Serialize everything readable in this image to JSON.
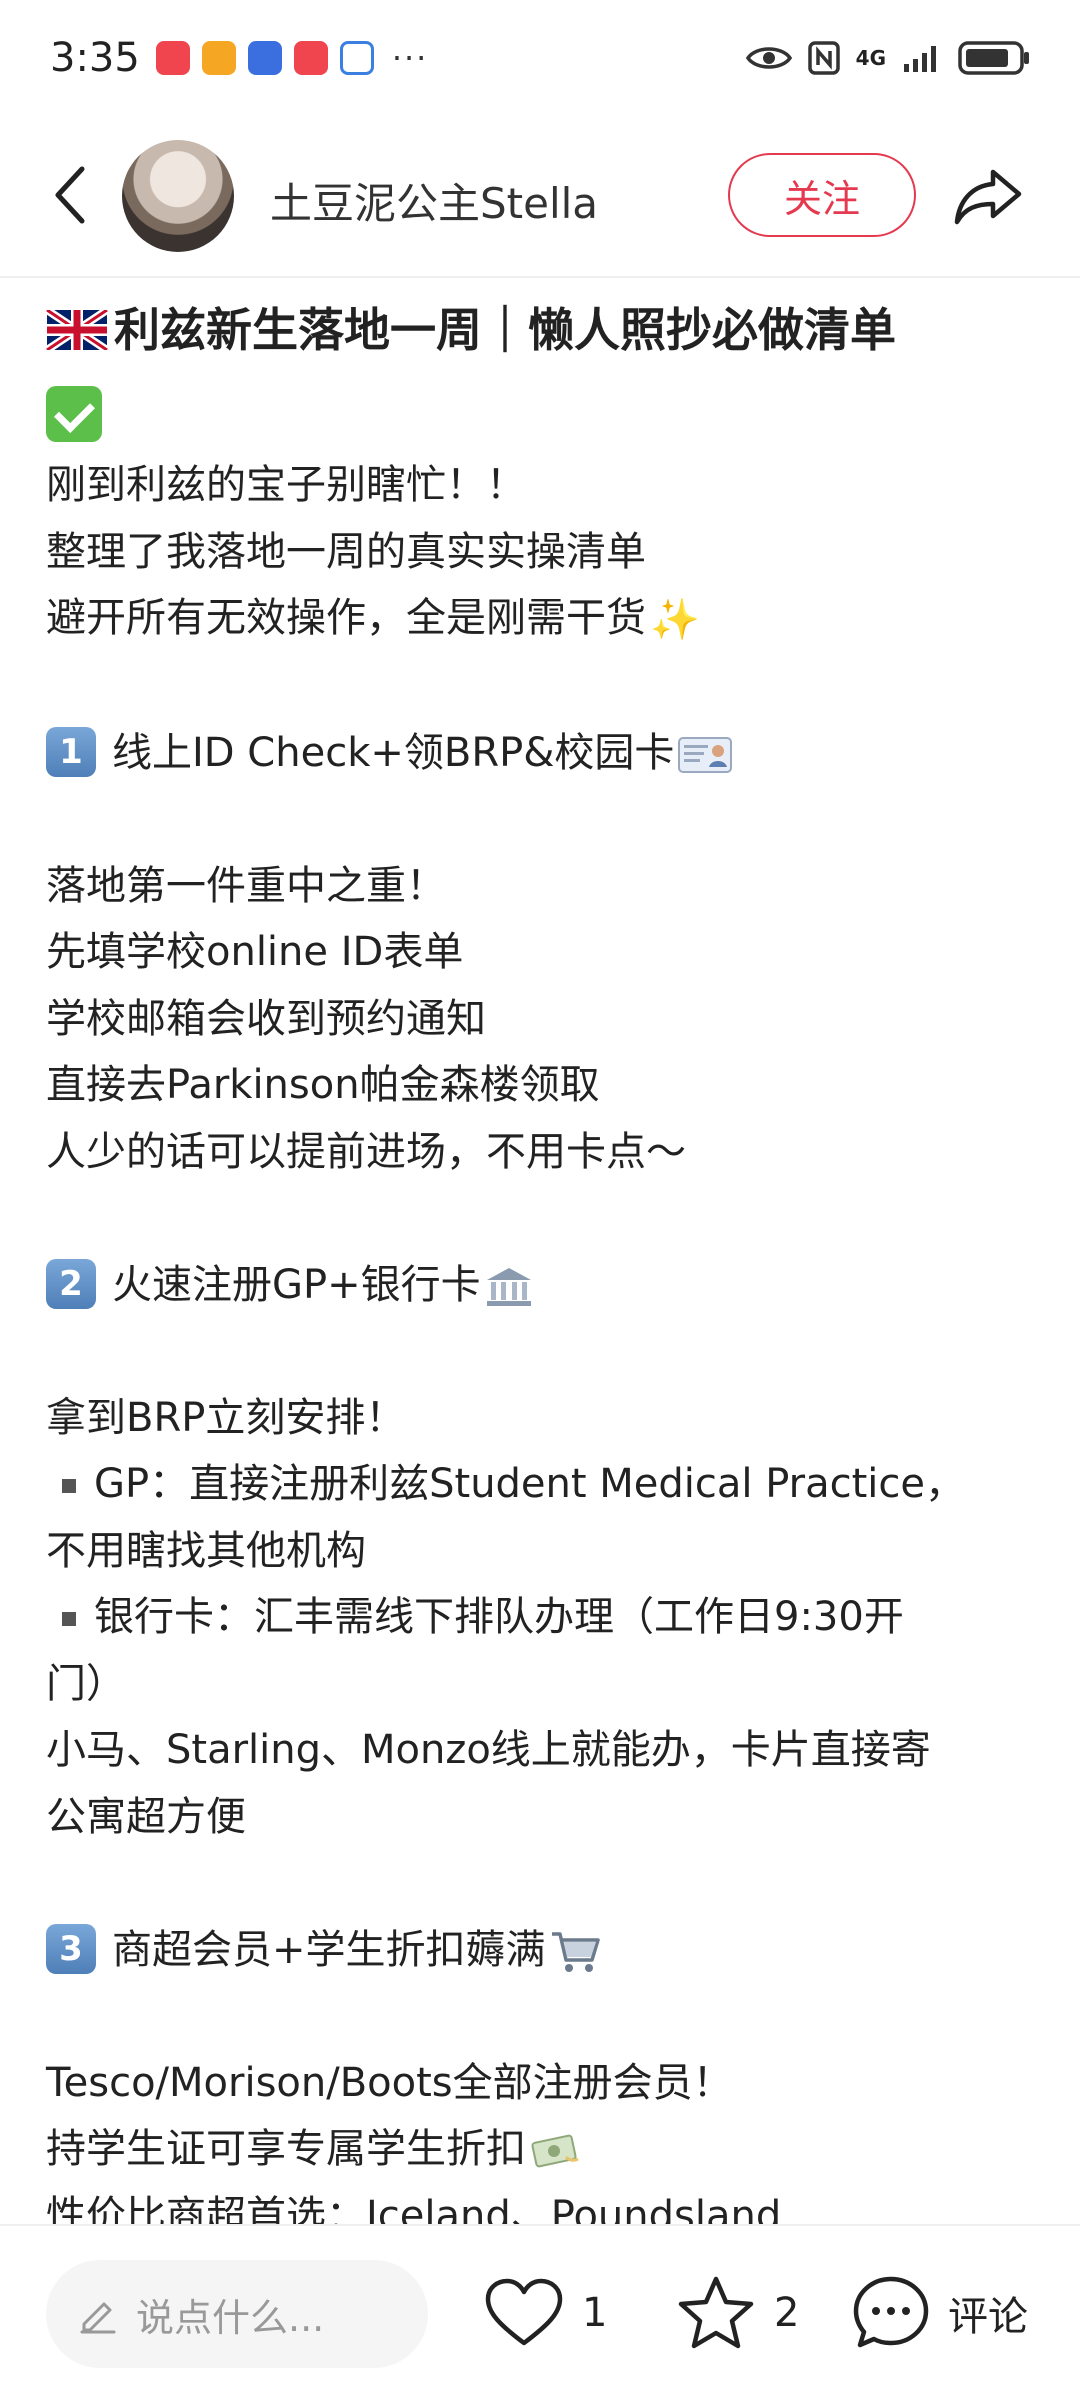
{
  "status_bar": {
    "time": "3:35",
    "more": "···",
    "network": "4G",
    "app_icon_colors": [
      "#f0454f",
      "#f5a623",
      "#3b6fe0",
      "#f0454f",
      "#3b7fe0"
    ]
  },
  "header": {
    "author_name": "土豆泥公主Stella",
    "follow_label": "关注"
  },
  "post": {
    "title": "利兹新生落地一周｜懒人照抄必做清单",
    "intro": [
      "刚到利兹的宝子别瞎忙！！",
      "整理了我落地一周的真实实操清单",
      "避开所有无效操作，全是刚需干货"
    ],
    "section1": {
      "number": "1",
      "heading": "线上ID Check+领BRP&校园卡",
      "lines": [
        "落地第一件重中之重！",
        "先填学校online ID表单",
        "学校邮箱会收到预约通知",
        "直接去Parkinson帕金森楼领取",
        "人少的话可以提前进场，不用卡点～"
      ]
    },
    "section2": {
      "number": "2",
      "heading": "火速注册GP+银行卡",
      "intro": "拿到BRP立刻安排！",
      "gp_line1": "GP：直接注册利兹Student Medical Practice，",
      "gp_line2": "不用瞎找其他机构",
      "bank_line1": "银行卡：汇丰需线下排队办理（工作日9:30开",
      "bank_line2": "门）",
      "online_line1": "小马、Starling、Monzo线上就能办，卡片直接寄",
      "online_line2": "公寓超方便"
    },
    "section3": {
      "number": "3",
      "heading": "商超会员+学生折扣薅满",
      "lines": [
        "Tesco/Morison/Boots全部注册会员！",
        "持学生证可享专属学生折扣",
        "性价比商超首选：Iceland、Poundsland"
      ]
    }
  },
  "bottom_bar": {
    "comment_placeholder": "说点什么...",
    "like_count": "1",
    "favorite_count": "2",
    "comment_label": "评论"
  },
  "colors": {
    "accent": "#e4394f",
    "text": "#222222",
    "muted": "#999999"
  }
}
